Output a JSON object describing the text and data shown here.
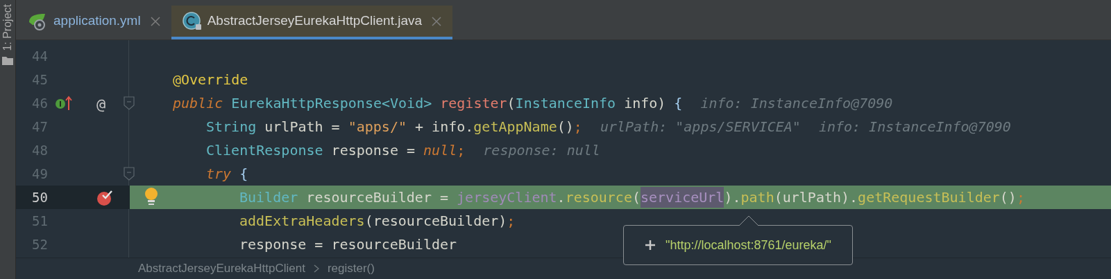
{
  "tool_strip": {
    "label": "1: Project"
  },
  "tabs": [
    {
      "label": "application.yml",
      "kind": "yaml",
      "selected": false
    },
    {
      "label": "AbstractJerseyEurekaHttpClient.java",
      "kind": "java",
      "selected": true
    }
  ],
  "lines": [
    {
      "number": "44",
      "current": false,
      "kind": "member"
    },
    {
      "number": "45",
      "current": false,
      "kind": "member",
      "tokens": [
        {
          "text": "@Override",
          "kind": "annotation"
        }
      ]
    },
    {
      "number": "46",
      "current": false,
      "kind": "member",
      "markers": [
        {
          "kind": "implements"
        },
        {
          "kind": "symbol",
          "text": "@"
        },
        {
          "kind": "fold"
        }
      ],
      "tokens": [
        {
          "text": "public",
          "kind": "keyword"
        },
        {
          "text": "EurekaHttpResponse<Void>",
          "kind": "type",
          "gap": true
        },
        {
          "text": "register",
          "kind": "declaration",
          "gap": true
        },
        {
          "text": "(",
          "kind": "plain"
        },
        {
          "text": "InstanceInfo",
          "kind": "type"
        },
        {
          "text": " info)",
          "kind": "plain"
        },
        {
          "text": "{",
          "kind": "brace",
          "gap": true
        },
        {
          "text": "info: InstanceInfo@7090",
          "kind": "hint"
        }
      ]
    },
    {
      "number": "47",
      "current": false,
      "kind": "statement",
      "tokens": [
        {
          "text": "String",
          "kind": "type"
        },
        {
          "text": " urlPath = ",
          "kind": "plain"
        },
        {
          "text": "\"apps/\"",
          "kind": "string"
        },
        {
          "text": " + info.",
          "kind": "plain"
        },
        {
          "text": "getAppName",
          "kind": "method"
        },
        {
          "text": "()",
          "kind": "plain"
        },
        {
          "text": ";",
          "kind": "punct"
        },
        {
          "text": "urlPath: \"apps/SERVICEA\"",
          "kind": "hint"
        },
        {
          "text": "info: InstanceInfo@7090",
          "kind": "hint"
        }
      ]
    },
    {
      "number": "48",
      "current": false,
      "kind": "statement",
      "tokens": [
        {
          "text": "ClientResponse",
          "kind": "type"
        },
        {
          "text": " response = ",
          "kind": "plain"
        },
        {
          "text": "null",
          "kind": "keyword"
        },
        {
          "text": ";",
          "kind": "punct"
        },
        {
          "text": "response: null",
          "kind": "hint"
        }
      ]
    },
    {
      "number": "49",
      "current": false,
      "kind": "statement",
      "markers": [
        {
          "kind": "fold"
        }
      ],
      "tokens": [
        {
          "text": "try",
          "kind": "keyword"
        },
        {
          "text": "{",
          "kind": "brace",
          "gap": true
        }
      ]
    },
    {
      "number": "50",
      "current": true,
      "kind": "nested",
      "markers": [
        {
          "kind": "breakpoint"
        },
        {
          "kind": "intention"
        }
      ],
      "tokens": [
        {
          "text": "Builder",
          "kind": "type"
        },
        {
          "text": " resourceBuilder = ",
          "kind": "plain"
        },
        {
          "text": "jerseyClient",
          "kind": "field"
        },
        {
          "text": ".",
          "kind": "plain"
        },
        {
          "text": "resource",
          "kind": "method"
        },
        {
          "text": "(",
          "kind": "plain"
        },
        {
          "text": "serviceUrl",
          "kind": "selection"
        },
        {
          "text": ").",
          "kind": "plain"
        },
        {
          "text": "path",
          "kind": "method"
        },
        {
          "text": "(urlPath).",
          "kind": "plain"
        },
        {
          "text": "getRequestBuilder",
          "kind": "method"
        },
        {
          "text": "()",
          "kind": "plain"
        },
        {
          "text": ";",
          "kind": "punct"
        }
      ]
    },
    {
      "number": "51",
      "current": false,
      "kind": "nested",
      "tokens": [
        {
          "text": "addExtraHeaders",
          "kind": "method"
        },
        {
          "text": "(resourceBuilder)",
          "kind": "plain"
        },
        {
          "text": ";",
          "kind": "punct"
        }
      ]
    },
    {
      "number": "52",
      "current": false,
      "kind": "nested",
      "tokens": [
        {
          "text": "response = resourceBuilder",
          "kind": "plain"
        }
      ]
    }
  ],
  "value_popup": {
    "text": "\"http://localhost:8761/eureka/\""
  },
  "breadcrumbs": [
    "AbstractJerseyEurekaHttpClient",
    "register()"
  ]
}
